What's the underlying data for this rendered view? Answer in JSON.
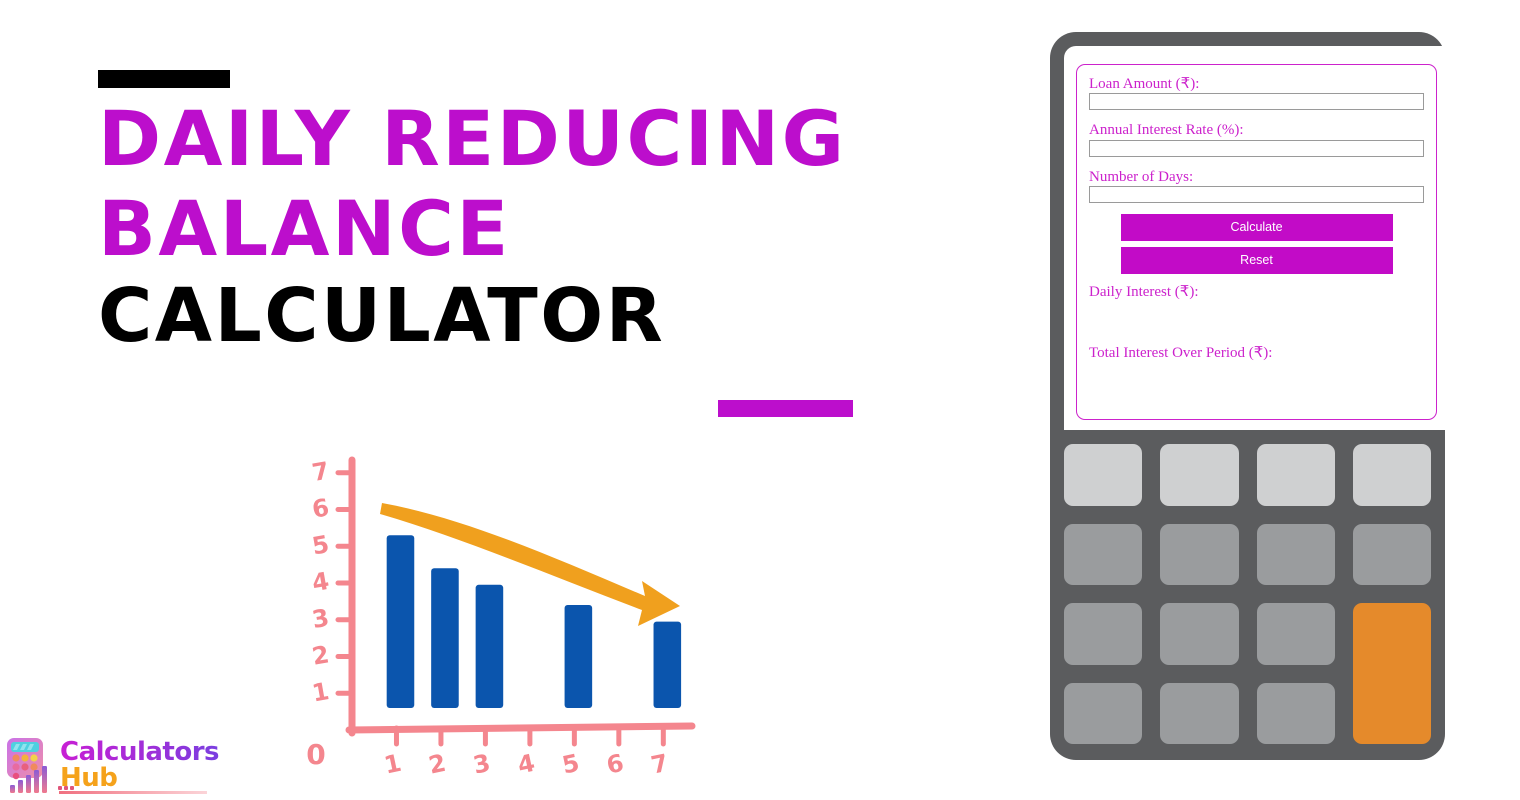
{
  "page": {
    "background": "#ffffff",
    "accent_magenta": "#BC0ECC",
    "accent_black": "#000000"
  },
  "title": {
    "line1": "DAILY REDUCING",
    "line2": "BALANCE",
    "line3": "CALCULATOR",
    "top_rule_color": "#000000",
    "bottom_rule_color": "#BC0ECC"
  },
  "logo": {
    "word1": "Calculators",
    "word2": "Hub",
    "word1_color": "#C81FD4",
    "word2_color": "#F5A21B",
    "icon_name": "calculator-bars-logo-icon"
  },
  "calculator_app": {
    "fields": [
      {
        "label": "Loan Amount (₹):",
        "value": "",
        "placeholder": "",
        "name": "loan-amount"
      },
      {
        "label": "Annual Interest Rate (%):",
        "value": "",
        "placeholder": "",
        "name": "annual-interest-rate"
      },
      {
        "label": "Number of Days:",
        "value": "",
        "placeholder": "",
        "name": "number-of-days"
      }
    ],
    "buttons": {
      "calculate": "Calculate",
      "reset": "Reset",
      "button_color": "#C20BC7",
      "button_text_color": "#ffffff"
    },
    "results": [
      {
        "label": "Daily Interest (₹):",
        "value": ""
      },
      {
        "label": "Total Interest Over Period (₹):",
        "value": ""
      }
    ],
    "label_color": "#CC22CC",
    "border_color": "#CC22CC"
  },
  "device": {
    "body_color": "#5b5c5e",
    "screen_color": "#ffffff",
    "key_color": "#9a9c9e",
    "key_light_color": "#cfd0d1",
    "key_accent_color": "#E58A2B",
    "keypad_rows": 4,
    "keypad_cols": 4
  },
  "chart_data": {
    "type": "bar",
    "title": "",
    "xlabel": "",
    "ylabel": "",
    "categories": [
      "1",
      "2",
      "3",
      "4",
      "5",
      "6",
      "7"
    ],
    "x_tick_labels": [
      "1",
      "2",
      "3",
      "4",
      "5",
      "6",
      "7"
    ],
    "y_tick_labels": [
      "1",
      "2",
      "3",
      "4",
      "5",
      "6",
      "7"
    ],
    "origin_label": "0",
    "xlim": [
      0,
      7.6
    ],
    "ylim": [
      0,
      7.4
    ],
    "grid": false,
    "legend": "none",
    "bar_color": "#0B55AD",
    "axis_color": "#F4868E",
    "bars": [
      {
        "x": 1,
        "value": 5.3
      },
      {
        "x": 2,
        "value": 4.4
      },
      {
        "x": 3,
        "value": 3.95
      },
      {
        "x": 5,
        "value": 3.4
      },
      {
        "x": 7,
        "value": 2.95
      }
    ],
    "values": [
      5.3,
      4.4,
      3.95,
      3.4,
      2.95
    ],
    "annotation": {
      "type": "arrow",
      "name": "downward-trend-arrow",
      "color": "#F0A01E",
      "direction": "down-right"
    }
  }
}
